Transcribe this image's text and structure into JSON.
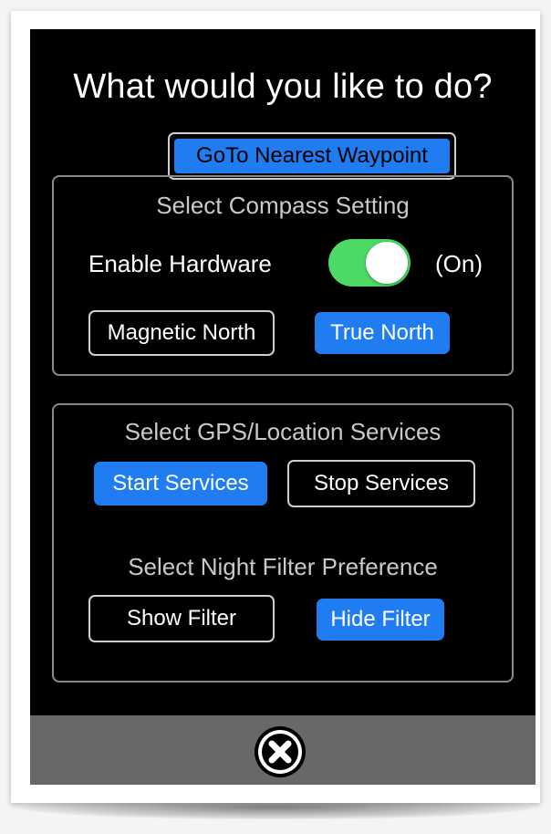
{
  "dialog": {
    "title": "What would you like to do?",
    "goto_label": "GoTo Nearest Waypoint"
  },
  "compass": {
    "title": "Select Compass Setting",
    "enable_label": "Enable Hardware",
    "toggle_state": "(On)",
    "toggle_on": true,
    "magnetic_label": "Magnetic North",
    "true_label": "True North",
    "selected": "True North"
  },
  "gps": {
    "title": "Select GPS/Location Services",
    "start_label": "Start Services",
    "stop_label": "Stop Services",
    "selected": "Start Services"
  },
  "night_filter": {
    "title": "Select Night Filter Preference",
    "show_label": "Show Filter",
    "hide_label": "Hide Filter",
    "selected": "Hide Filter"
  },
  "colors": {
    "accent": "#1f7cf1",
    "toggle_on": "#4cd964",
    "background": "#000000",
    "bottom_bar": "#686868"
  },
  "icons": {
    "close": "close-circle-icon"
  }
}
